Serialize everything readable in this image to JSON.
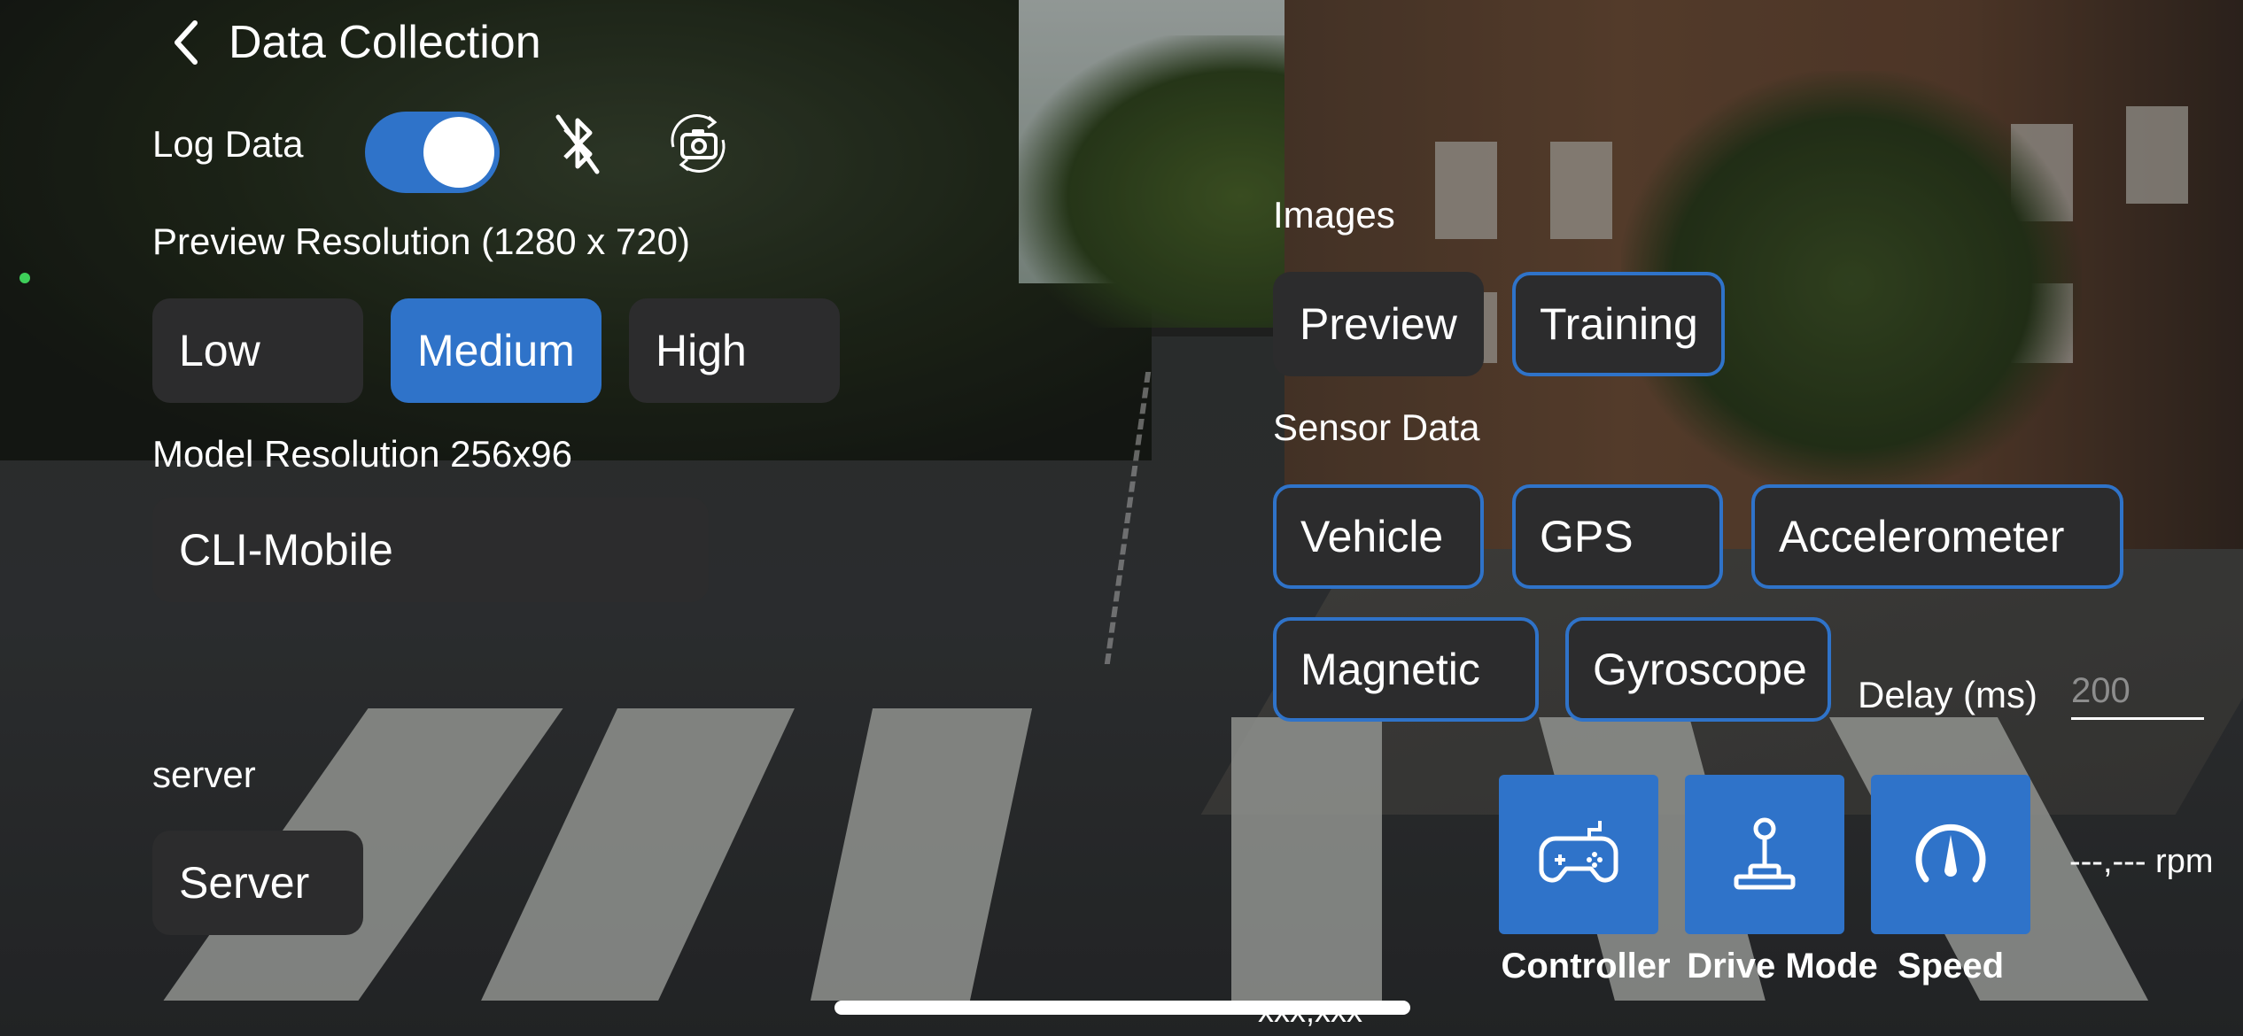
{
  "header": {
    "title": "Data Collection"
  },
  "log_data": {
    "label": "Log Data",
    "enabled": true
  },
  "preview_resolution": {
    "label": "Preview Resolution (1280 x 720)",
    "options": [
      "Low",
      "Medium",
      "High"
    ],
    "selected": "Medium"
  },
  "model": {
    "label": "Model Resolution 256x96",
    "value": "CLI-Mobile"
  },
  "server": {
    "label": "server",
    "value": "Server"
  },
  "images": {
    "label": "Images",
    "options": [
      "Preview",
      "Training"
    ],
    "selected": [
      "Training"
    ]
  },
  "sensor_data": {
    "label": "Sensor Data",
    "options": [
      "Vehicle",
      "GPS",
      "Accelerometer",
      "Magnetic",
      "Gyroscope"
    ]
  },
  "delay": {
    "label": "Delay (ms)",
    "placeholder": "200"
  },
  "controls": [
    {
      "label": "Controller",
      "icon": "gamepad-icon"
    },
    {
      "label": "Drive Mode",
      "icon": "joystick-icon"
    },
    {
      "label": "Speed",
      "icon": "speedometer-icon"
    }
  ],
  "speed_readout": "---,--- rpm",
  "bottom_readout": "xxx,xxx",
  "colors": {
    "accent": "#2f73c9",
    "button_bg": "#2c2c2d",
    "status_dot": "#3ecf5a"
  }
}
